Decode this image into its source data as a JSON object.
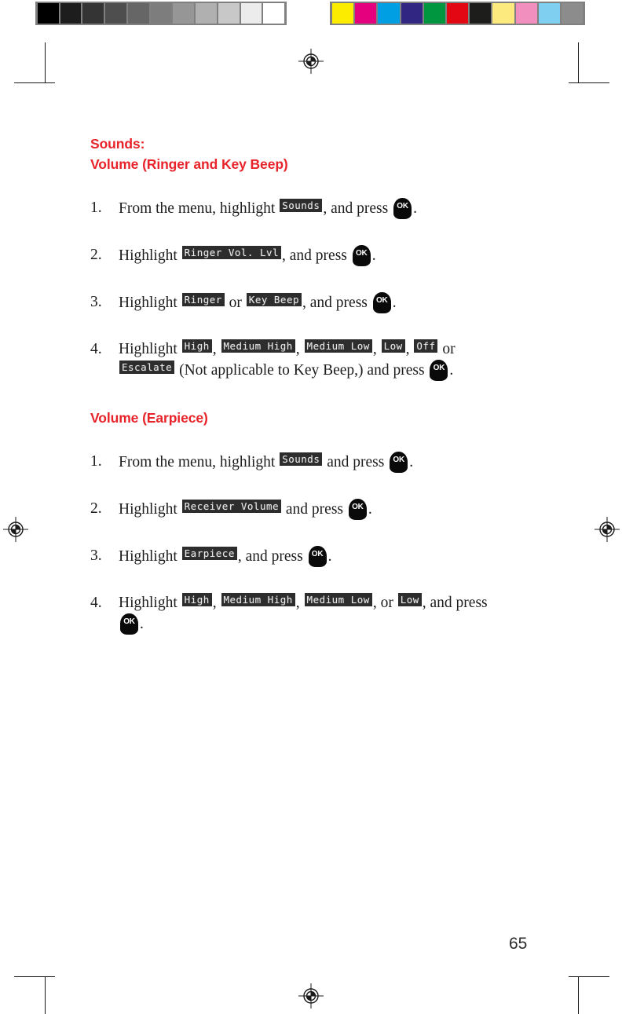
{
  "page": {
    "number": "65",
    "accent_color": "#e8232a",
    "text_color": "#1c1c1c"
  },
  "calibration": {
    "gray_bar": {
      "name": "grayscale-step-wedge",
      "swatches": [
        "#000000",
        "#1d1d1d",
        "#343434",
        "#4e4e4e",
        "#666666",
        "#7d7d7d",
        "#969696",
        "#b0b0b0",
        "#c8c8c8",
        "#ececec",
        "#ffffff"
      ]
    },
    "color_bar": {
      "name": "process-color-control-bar",
      "swatches": [
        "#fced00",
        "#e5007e",
        "#009fe3",
        "#312783",
        "#009640",
        "#e30613",
        "#1d1d1b",
        "#fdea7f",
        "#f18fbe",
        "#7fcff1",
        "#8c8c8c"
      ]
    }
  },
  "sections": [
    {
      "title": "Sounds:",
      "subtitle": "Volume (Ringer and Key Beep)",
      "steps": [
        {
          "number": "1.",
          "parts": [
            {
              "type": "text",
              "value": "From the menu, highlight "
            },
            {
              "type": "lcd",
              "value": "Sounds"
            },
            {
              "type": "text",
              "value": ", and press "
            },
            {
              "type": "okkey",
              "value": "OK"
            },
            {
              "type": "text",
              "value": "."
            }
          ]
        },
        {
          "number": "2.",
          "parts": [
            {
              "type": "text",
              "value": "Highlight "
            },
            {
              "type": "lcd",
              "value": "Ringer Vol. Lvl"
            },
            {
              "type": "text",
              "value": ", and press "
            },
            {
              "type": "okkey",
              "value": "OK"
            },
            {
              "type": "text",
              "value": "."
            }
          ]
        },
        {
          "number": "3.",
          "parts": [
            {
              "type": "text",
              "value": "Highlight "
            },
            {
              "type": "lcd",
              "value": "Ringer"
            },
            {
              "type": "text",
              "value": " or "
            },
            {
              "type": "lcd",
              "value": "Key Beep"
            },
            {
              "type": "text",
              "value": ", and press "
            },
            {
              "type": "okkey",
              "value": "OK"
            },
            {
              "type": "text",
              "value": "."
            }
          ]
        },
        {
          "number": "4.",
          "parts": [
            {
              "type": "text",
              "value": "Highlight "
            },
            {
              "type": "lcd",
              "value": "High"
            },
            {
              "type": "text",
              "value": ", "
            },
            {
              "type": "lcd",
              "value": "Medium High"
            },
            {
              "type": "text",
              "value": ", "
            },
            {
              "type": "lcd",
              "value": "Medium Low"
            },
            {
              "type": "text",
              "value": ", "
            },
            {
              "type": "lcd",
              "value": "Low"
            },
            {
              "type": "text",
              "value": ", "
            },
            {
              "type": "lcd",
              "value": "Off"
            },
            {
              "type": "text",
              "value": " or "
            },
            {
              "type": "break"
            },
            {
              "type": "lcd",
              "value": "Escalate"
            },
            {
              "type": "text",
              "value": " (Not applicable to Key Beep,) and press "
            },
            {
              "type": "okkey",
              "value": "OK"
            },
            {
              "type": "text",
              "value": "."
            }
          ]
        }
      ]
    },
    {
      "title": "",
      "subtitle": "Volume (Earpiece)",
      "steps": [
        {
          "number": "1.",
          "parts": [
            {
              "type": "text",
              "value": "From the menu, highlight "
            },
            {
              "type": "lcd",
              "value": "Sounds"
            },
            {
              "type": "text",
              "value": " and press "
            },
            {
              "type": "okkey",
              "value": "OK"
            },
            {
              "type": "text",
              "value": "."
            }
          ]
        },
        {
          "number": "2.",
          "parts": [
            {
              "type": "text",
              "value": "Highlight "
            },
            {
              "type": "lcd",
              "value": "Receiver Volume"
            },
            {
              "type": "text",
              "value": " and press "
            },
            {
              "type": "okkey",
              "value": "OK"
            },
            {
              "type": "text",
              "value": "."
            }
          ]
        },
        {
          "number": "3.",
          "parts": [
            {
              "type": "text",
              "value": "Highlight "
            },
            {
              "type": "lcd",
              "value": "Earpiece"
            },
            {
              "type": "text",
              "value": ", and press "
            },
            {
              "type": "okkey",
              "value": "OK"
            },
            {
              "type": "text",
              "value": "."
            }
          ]
        },
        {
          "number": "4.",
          "parts": [
            {
              "type": "text",
              "value": "Highlight "
            },
            {
              "type": "lcd",
              "value": "High"
            },
            {
              "type": "text",
              "value": ", "
            },
            {
              "type": "lcd",
              "value": "Medium High"
            },
            {
              "type": "text",
              "value": ", "
            },
            {
              "type": "lcd",
              "value": "Medium Low"
            },
            {
              "type": "text",
              "value": ", or "
            },
            {
              "type": "lcd",
              "value": "Low"
            },
            {
              "type": "text",
              "value": ", and press "
            },
            {
              "type": "break"
            },
            {
              "type": "okkey",
              "value": "OK"
            },
            {
              "type": "text",
              "value": "."
            }
          ]
        }
      ]
    }
  ]
}
